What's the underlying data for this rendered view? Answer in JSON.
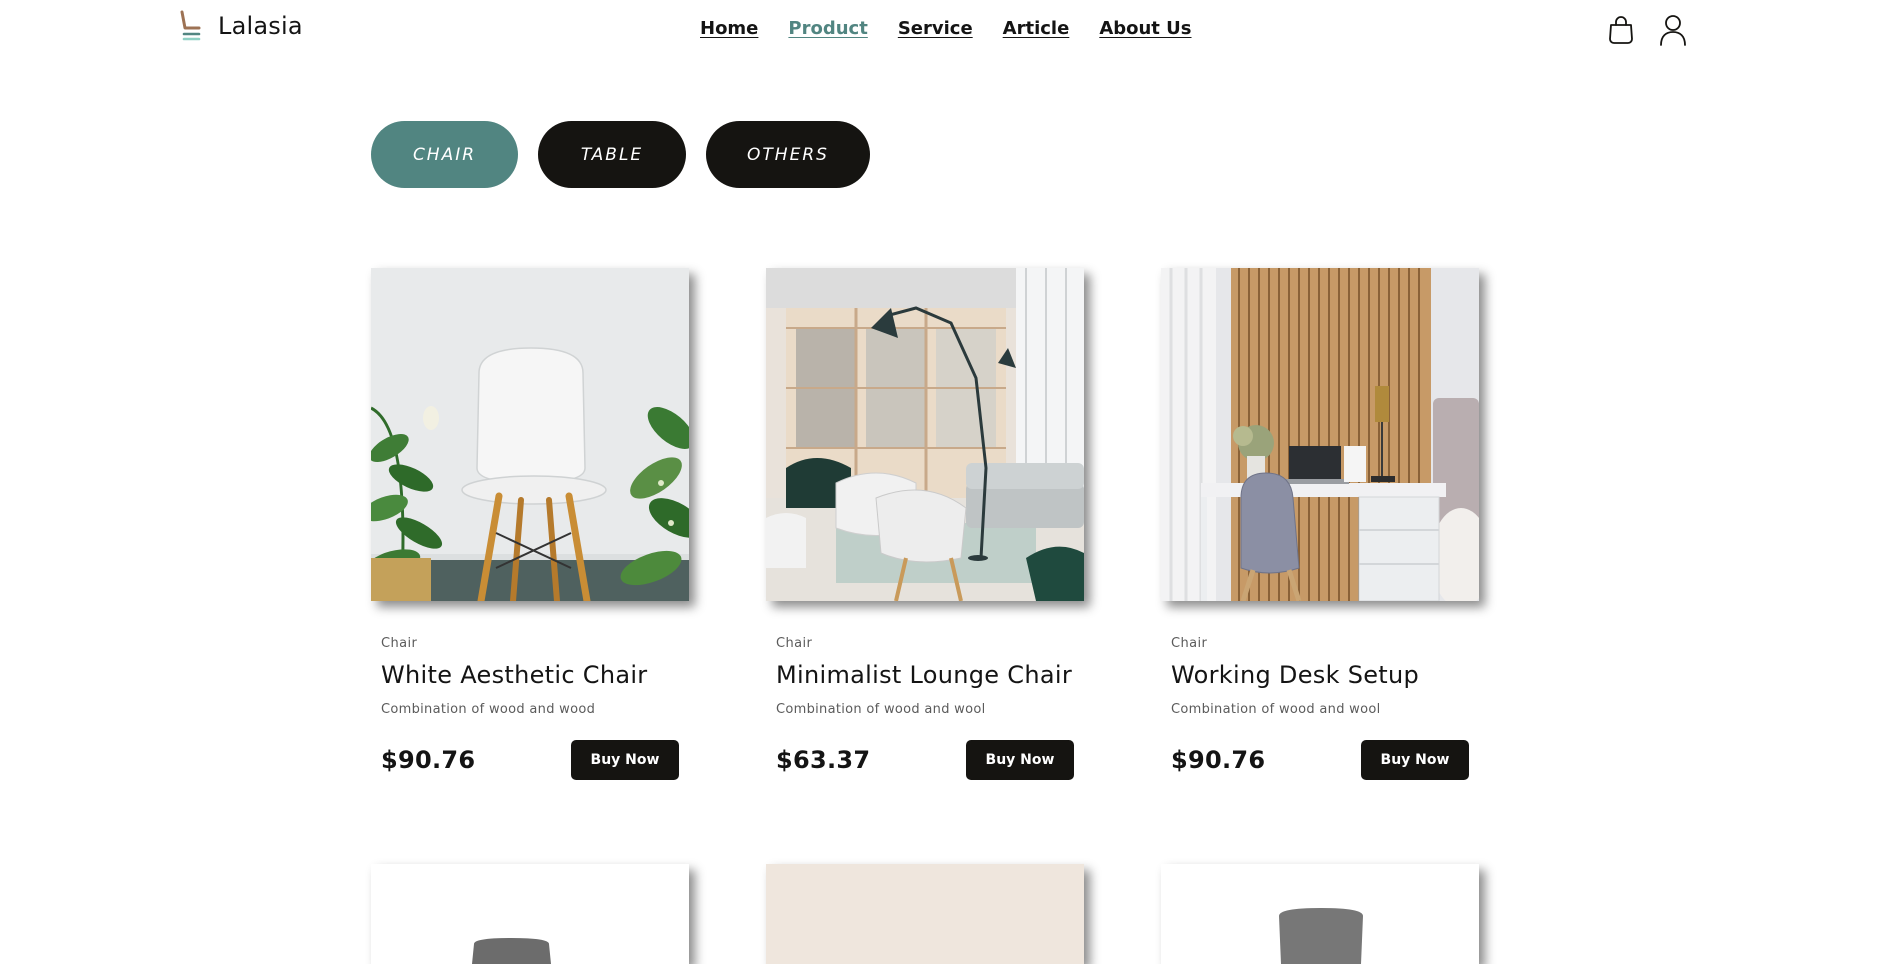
{
  "header": {
    "brand": "Lalasia",
    "nav": [
      {
        "label": "Home",
        "active": false
      },
      {
        "label": "Product",
        "active": true
      },
      {
        "label": "Service",
        "active": false
      },
      {
        "label": "Article",
        "active": false
      },
      {
        "label": "About Us",
        "active": false
      }
    ],
    "icons": [
      "bag-icon",
      "user-icon"
    ]
  },
  "tabs": [
    {
      "label": "CHAIR",
      "active": true
    },
    {
      "label": "TABLE",
      "active": false
    },
    {
      "label": "OTHERS",
      "active": false
    }
  ],
  "products": [
    {
      "category": "Chair",
      "title": "White Aesthetic Chair",
      "description": "Combination of wood and wood",
      "price": "$90.76",
      "button": "Buy Now"
    },
    {
      "category": "Chair",
      "title": "Minimalist Lounge Chair",
      "description": "Combination of wood and wool",
      "price": "$63.37",
      "button": "Buy Now"
    },
    {
      "category": "Chair",
      "title": "Working Desk Setup",
      "description": "Combination of wood and wool",
      "price": "$90.76",
      "button": "Buy Now"
    }
  ],
  "colors": {
    "accent": "#518581",
    "dark": "#151411",
    "muted_text": "#5b5b5b"
  }
}
